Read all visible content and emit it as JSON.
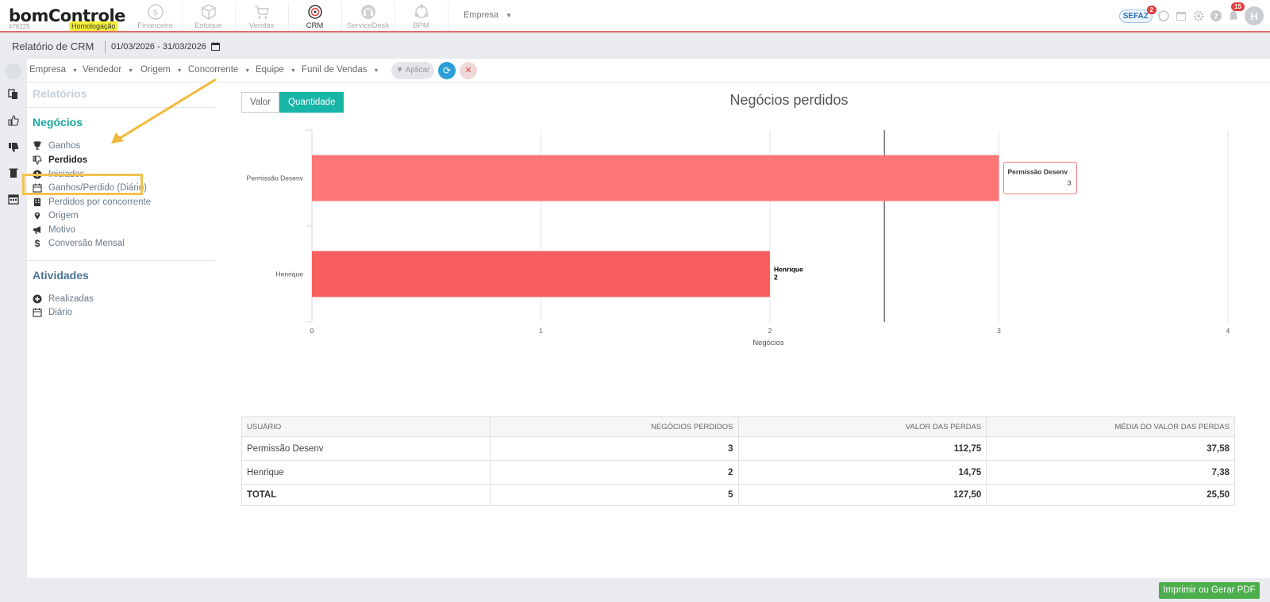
{
  "brand": {
    "logo": "bomControle",
    "account_id": "#76225",
    "env_badge": "Homologação"
  },
  "modules": [
    {
      "label": "Financeiro",
      "icon": "dollar-circle-icon"
    },
    {
      "label": "Estoque",
      "icon": "box-icon"
    },
    {
      "label": "Vendas",
      "icon": "cart-icon"
    },
    {
      "label": "CRM",
      "icon": "target-icon"
    },
    {
      "label": "ServiceDesk",
      "icon": "headset-icon"
    },
    {
      "label": "BPM",
      "icon": "process-icon"
    }
  ],
  "header": {
    "empresa_menu": "Empresa",
    "sefaz_label": "SEFAZ",
    "sefaz_badge": "2",
    "notif_badge": "15",
    "avatar_initial": "H"
  },
  "title_bar": {
    "title": "Relatório de CRM",
    "date_range": "01/03/2026 - 31/03/2026"
  },
  "filters": {
    "items": [
      "Empresa",
      "Vendedor",
      "Origem",
      "Concorrente",
      "Equipe",
      "Funil de Vendas"
    ],
    "apply_label": "Aplicar"
  },
  "sidebar": {
    "reports_heading": "Relatórios",
    "deals_heading": "Negócios",
    "deals_items": [
      {
        "label": "Ganhos",
        "icon": "trophy-icon"
      },
      {
        "label": "Perdidos",
        "icon": "thumbs-down-icon",
        "active": true
      },
      {
        "label": "Iniciados",
        "icon": "plus-circle-icon"
      },
      {
        "label": "Ganhos/Perdido (Diário)",
        "icon": "calendar-icon"
      },
      {
        "label": "Perdidos por concorrente",
        "icon": "building-icon"
      },
      {
        "label": "Origem",
        "icon": "map-marker-icon"
      },
      {
        "label": "Motivo",
        "icon": "megaphone-icon"
      },
      {
        "label": "Conversão Mensal",
        "icon": "dollar-icon"
      }
    ],
    "activities_heading": "Atividades",
    "activities_items": [
      {
        "label": "Realizadas",
        "icon": "plus-circle-icon"
      },
      {
        "label": "Diário",
        "icon": "calendar-icon"
      }
    ]
  },
  "toggle": {
    "valor": "Valor",
    "quantidade": "Quantidade",
    "selected": "Quantidade"
  },
  "chart_data": {
    "type": "bar",
    "orientation": "horizontal",
    "title": "Negócios perdidos",
    "xlabel": "Negócios",
    "ylabel": "",
    "categories": [
      "Permissão Desenv",
      "Henrique"
    ],
    "values": [
      3,
      2
    ],
    "xlim": [
      0,
      4
    ],
    "xticks": [
      "0",
      "1",
      "2",
      "3",
      "4"
    ],
    "bar_colors": [
      "#ff7676",
      "#f95e5e"
    ],
    "grid": true,
    "reference_line_value": 2.5,
    "tooltip": {
      "category": "Permissão Desenv",
      "value": "3"
    },
    "data_label": {
      "category": "Henrique",
      "value": "2"
    }
  },
  "table": {
    "headers": [
      "Usuário",
      "Negócios perdidos",
      "Valor das perdas",
      "Média do valor das perdas"
    ],
    "rows": [
      [
        "Permissão Desenv",
        "3",
        "112,75",
        "37,58"
      ],
      [
        "Henrique",
        "2",
        "14,75",
        "7,38"
      ]
    ],
    "total": [
      "TOTAL",
      "5",
      "127,50",
      "25,50"
    ]
  },
  "footer": {
    "pdf_button": "Imprimir ou Gerar PDF"
  },
  "colors": {
    "accent": "#17b5a8",
    "heading": "#17a89c",
    "brand_line": "#e36b6b",
    "pdf_green": "#4cae4c",
    "refresh_blue": "#2c9fd8"
  }
}
